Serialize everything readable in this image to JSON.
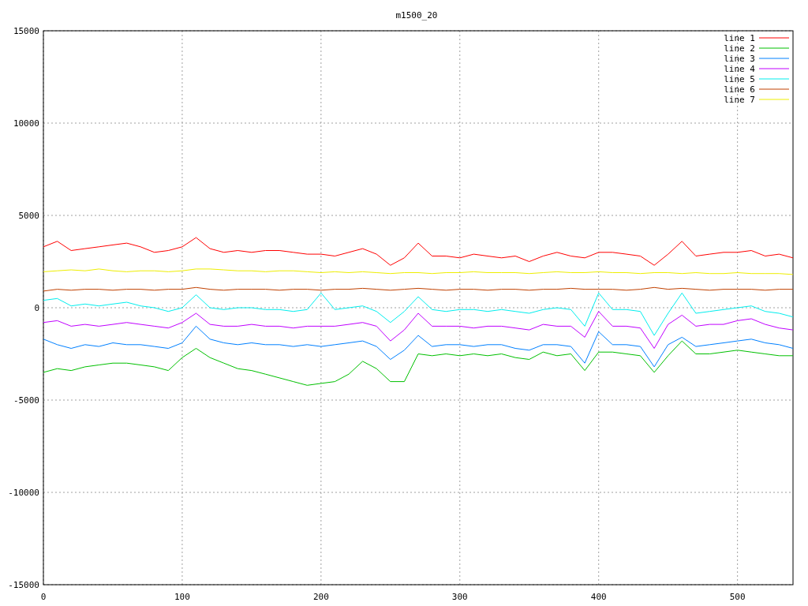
{
  "chart_data": {
    "type": "line",
    "title": "m1500_20",
    "x": [
      0,
      10,
      20,
      30,
      40,
      50,
      60,
      70,
      80,
      90,
      100,
      110,
      120,
      130,
      140,
      150,
      160,
      170,
      180,
      190,
      200,
      210,
      220,
      230,
      240,
      250,
      260,
      270,
      280,
      290,
      300,
      310,
      320,
      330,
      340,
      350,
      360,
      370,
      380,
      390,
      400,
      410,
      420,
      430,
      440,
      450,
      460,
      470,
      480,
      490,
      500,
      510,
      520,
      530,
      540
    ],
    "series": [
      {
        "name": "line 1",
        "color": "#ff0000",
        "values": [
          3300,
          3600,
          3100,
          3200,
          3300,
          3400,
          3500,
          3300,
          3000,
          3100,
          3300,
          3800,
          3200,
          3000,
          3100,
          3000,
          3100,
          3100,
          3000,
          2900,
          2900,
          2800,
          3000,
          3200,
          2900,
          2300,
          2700,
          3500,
          2800,
          2800,
          2700,
          2900,
          2800,
          2700,
          2800,
          2500,
          2800,
          3000,
          2800,
          2700,
          3000,
          3000,
          2900,
          2800,
          2300,
          2900,
          3600,
          2800,
          2900,
          3000,
          3000,
          3100,
          2800,
          2900,
          2700
        ]
      },
      {
        "name": "line 2",
        "color": "#00c000",
        "values": [
          -3500,
          -3300,
          -3400,
          -3200,
          -3100,
          -3000,
          -3000,
          -3100,
          -3200,
          -3400,
          -2700,
          -2200,
          -2700,
          -3000,
          -3300,
          -3400,
          -3600,
          -3800,
          -4000,
          -4200,
          -4100,
          -4000,
          -3600,
          -2900,
          -3300,
          -4000,
          -4000,
          -2500,
          -2600,
          -2500,
          -2600,
          -2500,
          -2600,
          -2500,
          -2700,
          -2800,
          -2400,
          -2600,
          -2500,
          -3400,
          -2400,
          -2400,
          -2500,
          -2600,
          -3500,
          -2600,
          -1800,
          -2500,
          -2500,
          -2400,
          -2300,
          -2400,
          -2500,
          -2600,
          -2600
        ]
      },
      {
        "name": "line 3",
        "color": "#0080ff",
        "values": [
          -1700,
          -2000,
          -2200,
          -2000,
          -2100,
          -1900,
          -2000,
          -2000,
          -2100,
          -2200,
          -1900,
          -1000,
          -1700,
          -1900,
          -2000,
          -1900,
          -2000,
          -2000,
          -2100,
          -2000,
          -2100,
          -2000,
          -1900,
          -1800,
          -2100,
          -2800,
          -2300,
          -1500,
          -2100,
          -2000,
          -2000,
          -2100,
          -2000,
          -2000,
          -2200,
          -2300,
          -2000,
          -2000,
          -2100,
          -3000,
          -1300,
          -2000,
          -2000,
          -2100,
          -3200,
          -2000,
          -1600,
          -2100,
          -2000,
          -1900,
          -1800,
          -1700,
          -1900,
          -2000,
          -2200
        ]
      },
      {
        "name": "line 4",
        "color": "#c000ff",
        "values": [
          -800,
          -700,
          -1000,
          -900,
          -1000,
          -900,
          -800,
          -900,
          -1000,
          -1100,
          -800,
          -300,
          -900,
          -1000,
          -1000,
          -900,
          -1000,
          -1000,
          -1100,
          -1000,
          -1000,
          -1000,
          -900,
          -800,
          -1000,
          -1800,
          -1200,
          -300,
          -1000,
          -1000,
          -1000,
          -1100,
          -1000,
          -1000,
          -1100,
          -1200,
          -900,
          -1000,
          -1000,
          -1600,
          -200,
          -1000,
          -1000,
          -1100,
          -2200,
          -900,
          -400,
          -1000,
          -900,
          -900,
          -700,
          -600,
          -900,
          -1100,
          -1200
        ]
      },
      {
        "name": "line 5",
        "color": "#00eeee",
        "values": [
          400,
          500,
          100,
          200,
          100,
          200,
          300,
          100,
          0,
          -200,
          0,
          700,
          0,
          -100,
          0,
          0,
          -100,
          -100,
          -200,
          -100,
          800,
          -100,
          0,
          100,
          -200,
          -800,
          -200,
          600,
          -100,
          -200,
          -100,
          -100,
          -200,
          -100,
          -200,
          -300,
          -100,
          0,
          -100,
          -1000,
          800,
          -100,
          -100,
          -200,
          -1500,
          -300,
          800,
          -300,
          -200,
          -100,
          0,
          100,
          -200,
          -300,
          -500
        ]
      },
      {
        "name": "line 6",
        "color": "#c04000",
        "values": [
          900,
          1000,
          950,
          1000,
          1000,
          950,
          1000,
          1000,
          950,
          1000,
          1000,
          1100,
          1000,
          950,
          1000,
          1000,
          1000,
          950,
          1000,
          1000,
          950,
          1000,
          1000,
          1050,
          1000,
          950,
          1000,
          1050,
          1000,
          950,
          1000,
          1000,
          950,
          1000,
          1000,
          950,
          1000,
          1000,
          1050,
          1000,
          1000,
          1000,
          950,
          1000,
          1100,
          1000,
          1050,
          1000,
          950,
          1000,
          1000,
          1000,
          950,
          1000,
          1000
        ]
      },
      {
        "name": "line 7",
        "color": "#eeee00",
        "values": [
          1950,
          2000,
          2050,
          2000,
          2100,
          2000,
          1950,
          2000,
          2000,
          1950,
          2000,
          2100,
          2100,
          2050,
          2000,
          2000,
          1950,
          2000,
          2000,
          1950,
          1900,
          1950,
          1900,
          1950,
          1900,
          1850,
          1900,
          1900,
          1850,
          1900,
          1900,
          1950,
          1900,
          1900,
          1900,
          1850,
          1900,
          1950,
          1900,
          1900,
          1950,
          1900,
          1900,
          1850,
          1900,
          1900,
          1850,
          1900,
          1850,
          1850,
          1900,
          1850,
          1850,
          1850,
          1800
        ]
      }
    ],
    "grid": true,
    "legend": true,
    "xlim": [
      0,
      540
    ],
    "ylim": [
      -15000,
      15000
    ],
    "xticks": [
      0,
      100,
      200,
      300,
      400,
      500
    ],
    "yticks": [
      -15000,
      -10000,
      -5000,
      0,
      5000,
      10000,
      15000
    ]
  }
}
